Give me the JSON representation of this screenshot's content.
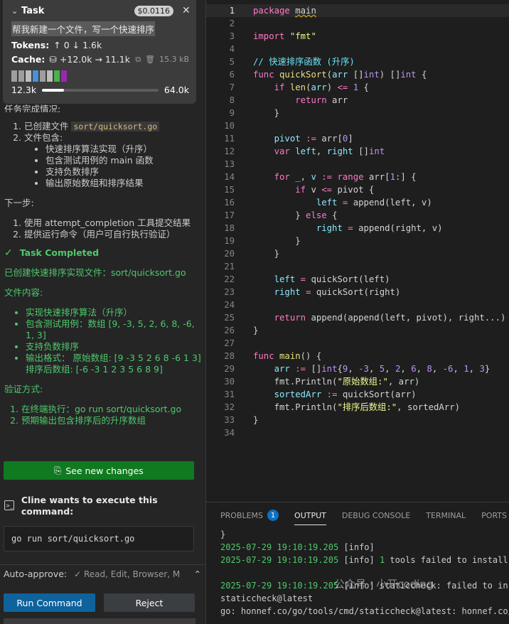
{
  "task_card": {
    "title": "Task",
    "cost": "$0.0116",
    "prompt": "帮我新建一个文件，写一个快速排序",
    "tokens_label": "Tokens:",
    "tokens_value": "↑ 0 ↓ 1.6k",
    "cache_label": "Cache:",
    "cache_value": "+12.0k → 11.1k",
    "cache_size": "15.3 kB",
    "context_left": "12.3k",
    "context_right": "64.0k",
    "context_fill": 0.19,
    "blocks": [
      "#9e9e9e",
      "#9e9e9e",
      "#bdbdbd",
      "#4a90d9",
      "#9e9e9e",
      "#bdbdbd",
      "#4caf50",
      "#9c27b0"
    ]
  },
  "chat": {
    "cut_line": "任务完成情况:",
    "ol1": [
      {
        "text": "已创建文件 ",
        "chip": "sort/quicksort.go"
      },
      {
        "text": "文件包含:",
        "chip": ""
      }
    ],
    "ol1_sub": [
      "快速排序算法实现（升序）",
      "包含测试用例的 main 函数",
      "支持负数排序",
      "输出原始数组和排序结果"
    ],
    "next_label": "下一步:",
    "ol2": [
      "使用 attempt_completion 工具提交结果",
      "提供运行命令（用户可自行执行验证）"
    ],
    "task_completed": "Task Completed",
    "created_line": "已创建快速排序实现文件：sort/quicksort.go",
    "content_label": "文件内容:",
    "content_items": [
      "实现快速排序算法（升序）",
      "包含测试用例：数组 [9, -3, 5, 2, 6, 8, -6, 1, 3]",
      "支持负数排序",
      "输出格式： 原始数组: [9 -3 5 2 6 8 -6 1 3] 排序后数组: [-6 -3 1 2 3 5 6 8 9]"
    ],
    "verify_label": "验证方式:",
    "verify_items": [
      "在终端执行：go run sort/quicksort.go",
      "预期输出包含排序后的升序数组"
    ]
  },
  "see_changes_label": "See new changes",
  "cline_wants": "Cline wants to execute this command:",
  "command": "go run sort/quicksort.go",
  "auto_approve_label": "Auto-approve:",
  "auto_approve_items": "✓ Read, Edit, Browser, M",
  "run_label": "Run Command",
  "reject_label": "Reject",
  "editor": {
    "current_line": 1,
    "lines": [
      [
        [
          "kw",
          "package"
        ],
        [
          "t",
          " "
        ],
        [
          "sq",
          "main"
        ]
      ],
      [],
      [
        [
          "kw",
          "import"
        ],
        [
          "t",
          " "
        ],
        [
          "str",
          "\"fmt\""
        ]
      ],
      [],
      [
        [
          "cmt",
          "// 快速排序函数 (升序)"
        ]
      ],
      [
        [
          "kw",
          "func"
        ],
        [
          "t",
          " "
        ],
        [
          "fn",
          "quickSort"
        ],
        [
          "t",
          "("
        ],
        [
          "vr",
          "arr"
        ],
        [
          "t",
          " []"
        ],
        [
          "tp",
          "int"
        ],
        [
          "t",
          ") []"
        ],
        [
          "tp",
          "int"
        ],
        [
          "t",
          " {"
        ]
      ],
      [
        [
          "t",
          "    "
        ],
        [
          "kw",
          "if"
        ],
        [
          "t",
          " "
        ],
        [
          "fn",
          "len"
        ],
        [
          "t",
          "("
        ],
        [
          "vr",
          "arr"
        ],
        [
          "t",
          ") "
        ],
        [
          "op",
          "<="
        ],
        [
          "t",
          " "
        ],
        [
          "num",
          "1"
        ],
        [
          "t",
          " {"
        ]
      ],
      [
        [
          "t",
          "        "
        ],
        [
          "kw",
          "return"
        ],
        [
          "t",
          " arr"
        ]
      ],
      [
        [
          "t",
          "    }"
        ]
      ],
      [],
      [
        [
          "t",
          "    "
        ],
        [
          "vr",
          "pivot"
        ],
        [
          "t",
          " "
        ],
        [
          "op",
          ":="
        ],
        [
          "t",
          " arr["
        ],
        [
          "num",
          "0"
        ],
        [
          "t",
          "]"
        ]
      ],
      [
        [
          "t",
          "    "
        ],
        [
          "kw",
          "var"
        ],
        [
          "t",
          " "
        ],
        [
          "vr",
          "left"
        ],
        [
          "t",
          ", "
        ],
        [
          "vr",
          "right"
        ],
        [
          "t",
          " []"
        ],
        [
          "tp",
          "int"
        ]
      ],
      [],
      [
        [
          "t",
          "    "
        ],
        [
          "kw",
          "for"
        ],
        [
          "t",
          " _, "
        ],
        [
          "vr",
          "v"
        ],
        [
          "t",
          " "
        ],
        [
          "op",
          ":="
        ],
        [
          "t",
          " "
        ],
        [
          "kw",
          "range"
        ],
        [
          "t",
          " arr["
        ],
        [
          "num",
          "1"
        ],
        [
          "t",
          ":] {"
        ]
      ],
      [
        [
          "t",
          "        "
        ],
        [
          "kw",
          "if"
        ],
        [
          "t",
          " v "
        ],
        [
          "op",
          "<="
        ],
        [
          "t",
          " pivot {"
        ]
      ],
      [
        [
          "t",
          "            "
        ],
        [
          "vr",
          "left"
        ],
        [
          "t",
          " "
        ],
        [
          "op",
          "="
        ],
        [
          "t",
          " "
        ],
        [
          "t",
          "append"
        ],
        [
          "t",
          "(left, v)"
        ]
      ],
      [
        [
          "t",
          "        } "
        ],
        [
          "kw",
          "else"
        ],
        [
          "t",
          " {"
        ]
      ],
      [
        [
          "t",
          "            "
        ],
        [
          "vr",
          "right"
        ],
        [
          "t",
          " "
        ],
        [
          "op",
          "="
        ],
        [
          "t",
          " append(right, v)"
        ]
      ],
      [
        [
          "t",
          "        }"
        ]
      ],
      [
        [
          "t",
          "    }"
        ]
      ],
      [],
      [
        [
          "t",
          "    "
        ],
        [
          "vr",
          "left"
        ],
        [
          "t",
          " "
        ],
        [
          "op",
          "="
        ],
        [
          "t",
          " quickSort(left)"
        ]
      ],
      [
        [
          "t",
          "    "
        ],
        [
          "vr",
          "right"
        ],
        [
          "t",
          " "
        ],
        [
          "op",
          "="
        ],
        [
          "t",
          " quickSort(right)"
        ]
      ],
      [],
      [
        [
          "t",
          "    "
        ],
        [
          "kw",
          "return"
        ],
        [
          "t",
          " append(append(left, pivot), right...)"
        ]
      ],
      [
        [
          "t",
          "}"
        ]
      ],
      [],
      [
        [
          "kw",
          "func"
        ],
        [
          "t",
          " "
        ],
        [
          "fn",
          "main"
        ],
        [
          "t",
          "() {"
        ]
      ],
      [
        [
          "t",
          "    "
        ],
        [
          "vr",
          "arr"
        ],
        [
          "t",
          " "
        ],
        [
          "op",
          ":="
        ],
        [
          "t",
          " []"
        ],
        [
          "tp",
          "int"
        ],
        [
          "t",
          "{"
        ],
        [
          "num",
          "9"
        ],
        [
          "t",
          ", "
        ],
        [
          "num",
          "-3"
        ],
        [
          "t",
          ", "
        ],
        [
          "num",
          "5"
        ],
        [
          "t",
          ", "
        ],
        [
          "num",
          "2"
        ],
        [
          "t",
          ", "
        ],
        [
          "num",
          "6"
        ],
        [
          "t",
          ", "
        ],
        [
          "num",
          "8"
        ],
        [
          "t",
          ", "
        ],
        [
          "num",
          "-6"
        ],
        [
          "t",
          ", "
        ],
        [
          "num",
          "1"
        ],
        [
          "t",
          ", "
        ],
        [
          "num",
          "3"
        ],
        [
          "t",
          "}"
        ]
      ],
      [
        [
          "t",
          "    fmt.Println("
        ],
        [
          "str",
          "\"原始数组:\""
        ],
        [
          "t",
          ", arr)"
        ]
      ],
      [
        [
          "t",
          "    "
        ],
        [
          "vr",
          "sortedArr"
        ],
        [
          "t",
          " "
        ],
        [
          "op",
          ":="
        ],
        [
          "t",
          " quickSort(arr)"
        ]
      ],
      [
        [
          "t",
          "    fmt.Println("
        ],
        [
          "str",
          "\"排序后数组:\""
        ],
        [
          "t",
          ", sortedArr)"
        ]
      ],
      [
        [
          "t",
          "}"
        ]
      ],
      []
    ]
  },
  "panel": {
    "tabs": [
      "PROBLEMS",
      "OUTPUT",
      "DEBUG CONSOLE",
      "TERMINAL",
      "PORTS"
    ],
    "problems_count": "1",
    "active_tab": "OUTPUT",
    "output_lines": [
      [
        [
          "t",
          "}"
        ]
      ],
      [
        [
          "ts",
          "2025-07-29 19:10:19.205"
        ],
        [
          "t",
          " [info]"
        ]
      ],
      [
        [
          "ts",
          "2025-07-29 19:10:19.205"
        ],
        [
          "t",
          " [info] "
        ],
        [
          "hn",
          "1"
        ],
        [
          "t",
          " tools failed to install"
        ]
      ],
      [],
      [
        [
          "ts",
          "2025-07-29 19:10:19.205"
        ],
        [
          "t",
          " [info] staticcheck: failed to in"
        ]
      ],
      [
        [
          "t",
          "staticcheck@latest"
        ]
      ],
      [
        [
          "t",
          "go: honnef.co/go/tools/cmd/staticcheck@latest: honnef.co/"
        ]
      ]
    ],
    "watermark": "公众号 · 小开coding"
  }
}
